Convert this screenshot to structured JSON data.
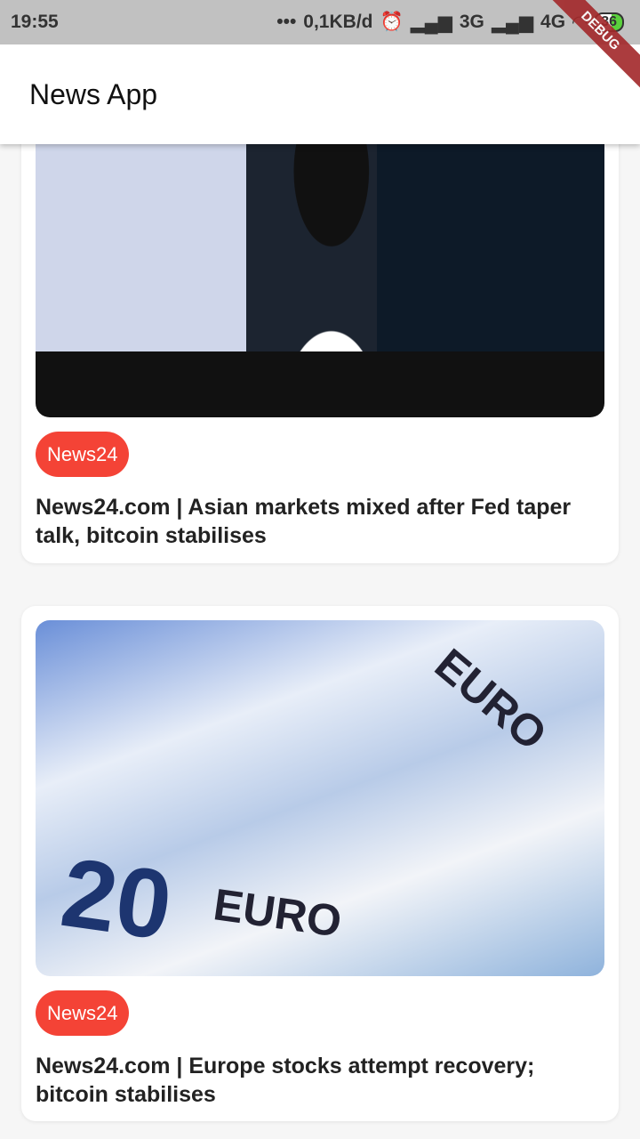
{
  "status_bar": {
    "time": "19:55",
    "dots": "•••",
    "data_rate": "0,1KB/d",
    "alarm_icon": "alarm-icon",
    "network1": "3G",
    "network2": "4G",
    "battery": "36"
  },
  "debug_banner": "DEBUG",
  "app_bar": {
    "title": "News App"
  },
  "articles": [
    {
      "source": "News24",
      "title": "News24.com | Asian markets mixed after Fed taper talk, bitcoin stabilises"
    },
    {
      "source": "News24",
      "title": "News24.com | Europe stocks attempt recovery; bitcoin stabilises"
    }
  ],
  "colors": {
    "badge": "#f44336",
    "status_bar": "#c1c1c1"
  }
}
